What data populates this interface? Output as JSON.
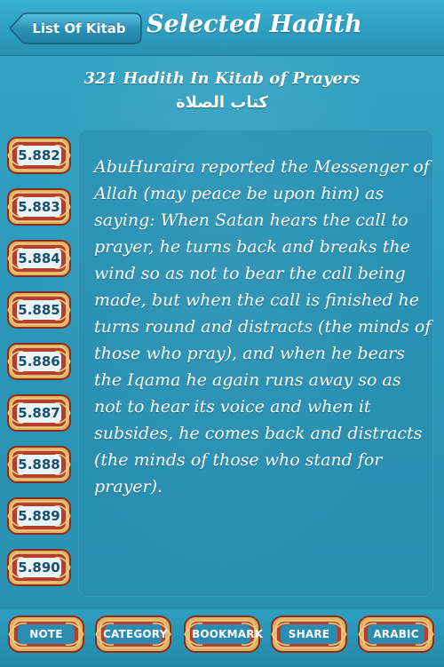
{
  "header": {
    "back_label": "List Of Kitab",
    "title": "Selected Hadith"
  },
  "kitab": {
    "subtitle": "321 Hadith In Kitab of Prayers",
    "arabic": "كتاب الصلاة"
  },
  "hadith_list": [
    "5.882",
    "5.883",
    "5.884",
    "5.885",
    "5.886",
    "5.887",
    "5.888",
    "5.889",
    "5.890"
  ],
  "hadith_text": "AbuHuraira reported the Messenger of Allah (may peace be upon him) as saying: When Satan hears the call to prayer, he turns back and breaks the wind so as not to bear the call being made, but when the call is finished he turns round and distracts (the minds of those who pray), and when he bears the Iqama he again runs away so as not to hear its voice and when it subsides, he comes back and distracts (the minds of those who stand for prayer).",
  "toolbar": {
    "note": "NOTE",
    "category": "CATEGORY",
    "bookmark": "BOOKMARK",
    "share": "SHARE",
    "arabic": "ARABIC"
  },
  "colors": {
    "background": "#2e9bbd",
    "ornament_red": "#b4402c",
    "ornament_gold": "#e1b360",
    "panel": "#2a8cb0"
  }
}
